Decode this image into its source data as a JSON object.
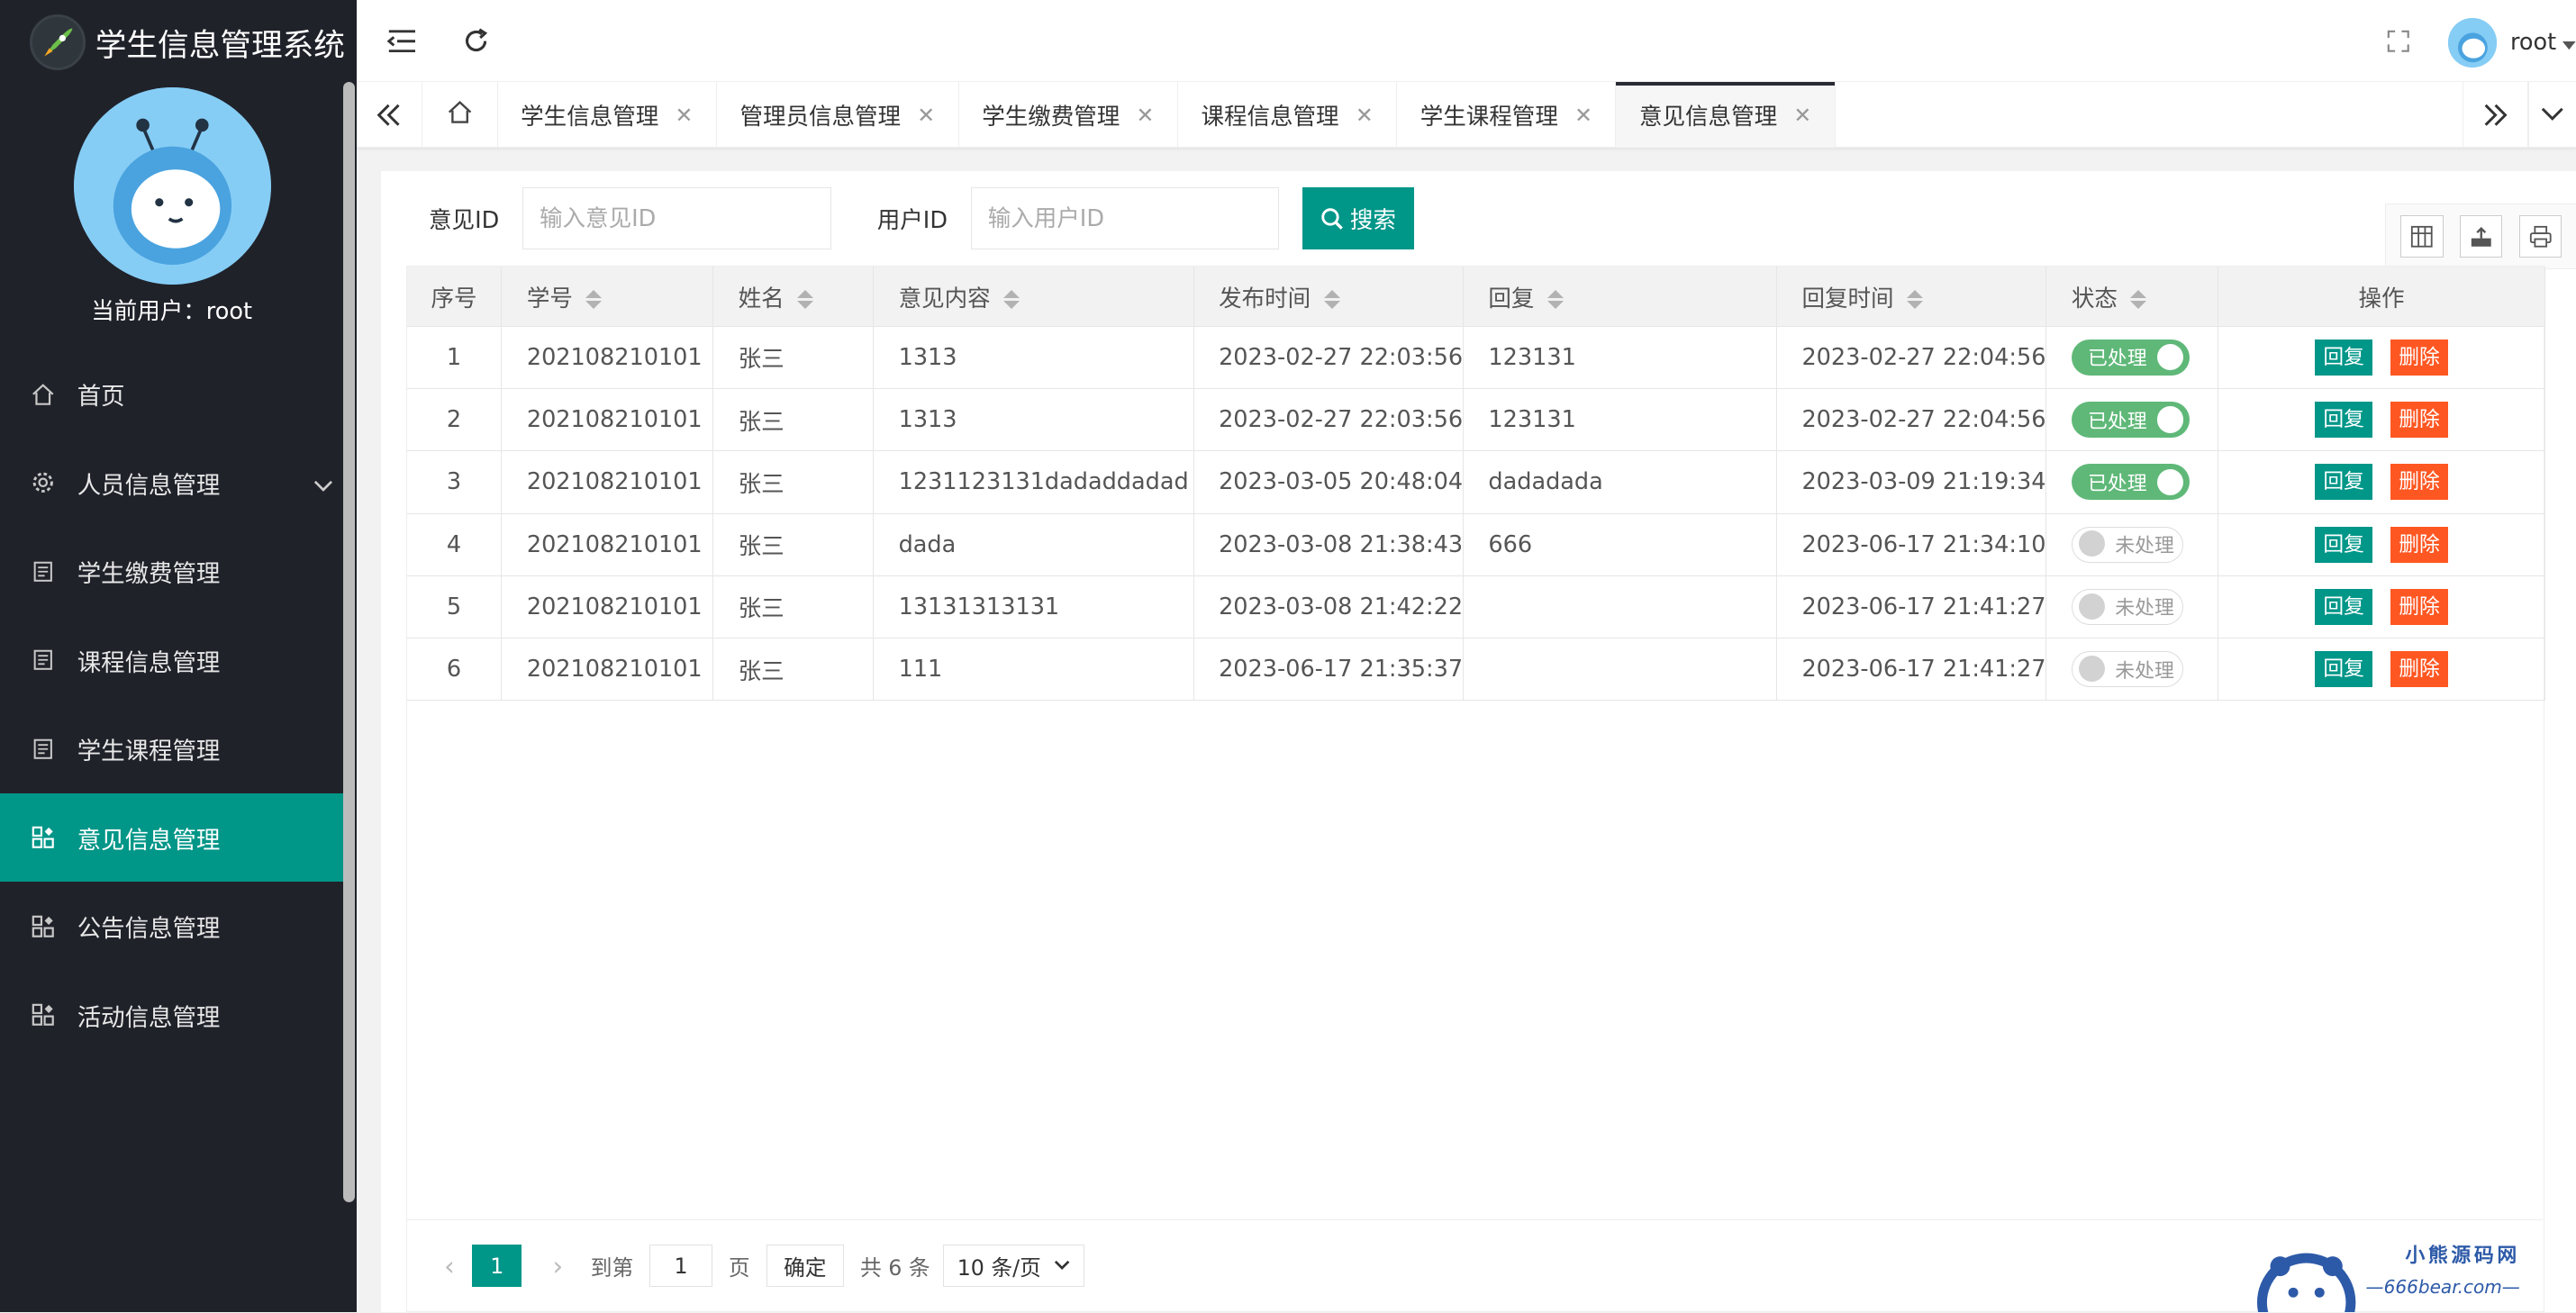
{
  "app": {
    "title": "学生信息管理系统"
  },
  "sidebar": {
    "current_user_label": "当前用户：root",
    "items": [
      {
        "label": "首页",
        "icon": "home-icon"
      },
      {
        "label": "人员信息管理",
        "icon": "gear-icon"
      },
      {
        "label": "学生缴费管理",
        "icon": "doc-icon"
      },
      {
        "label": "课程信息管理",
        "icon": "doc-icon"
      },
      {
        "label": "学生课程管理",
        "icon": "doc-icon"
      },
      {
        "label": "意见信息管理",
        "icon": "app-icon"
      },
      {
        "label": "公告信息管理",
        "icon": "app-icon"
      },
      {
        "label": "活动信息管理",
        "icon": "app-icon"
      }
    ]
  },
  "header": {
    "user": "root"
  },
  "tabs": [
    {
      "label": "学生信息管理"
    },
    {
      "label": "管理员信息管理"
    },
    {
      "label": "学生缴费管理"
    },
    {
      "label": "课程信息管理"
    },
    {
      "label": "学生课程管理"
    },
    {
      "label": "意见信息管理"
    }
  ],
  "search": {
    "opinion_id_label": "意见ID",
    "opinion_id_placeholder": "输入意见ID",
    "user_id_label": "用户ID",
    "user_id_placeholder": "输入用户ID",
    "button": "搜索"
  },
  "table": {
    "headers": [
      "序号",
      "学号",
      "姓名",
      "意见内容",
      "发布时间",
      "回复",
      "回复时间",
      "状态",
      "操作"
    ],
    "rows": [
      {
        "no": "1",
        "sid": "202108210101",
        "name": "张三",
        "content": "1313",
        "time": "2023-02-27 22:03:56",
        "reply": "123131",
        "reply_time": "2023-02-27 22:04:56",
        "status": "已处理",
        "on": true
      },
      {
        "no": "2",
        "sid": "202108210101",
        "name": "张三",
        "content": "1313",
        "time": "2023-02-27 22:03:56",
        "reply": "123131",
        "reply_time": "2023-02-27 22:04:56",
        "status": "已处理",
        "on": true
      },
      {
        "no": "3",
        "sid": "202108210101",
        "name": "张三",
        "content": "1231123131dadaddadad",
        "time": "2023-03-05 20:48:04",
        "reply": "dadadada",
        "reply_time": "2023-03-09 21:19:34",
        "status": "已处理",
        "on": true
      },
      {
        "no": "4",
        "sid": "202108210101",
        "name": "张三",
        "content": "dada",
        "time": "2023-03-08 21:38:43",
        "reply": "666",
        "reply_time": "2023-06-17 21:34:10",
        "status": "未处理",
        "on": false
      },
      {
        "no": "5",
        "sid": "202108210101",
        "name": "张三",
        "content": "13131313131",
        "time": "2023-03-08 21:42:22",
        "reply": "",
        "reply_time": "2023-06-17 21:41:27",
        "status": "未处理",
        "on": false
      },
      {
        "no": "6",
        "sid": "202108210101",
        "name": "张三",
        "content": "111",
        "time": "2023-06-17 21:35:37",
        "reply": "",
        "reply_time": "2023-06-17 21:41:27",
        "status": "未处理",
        "on": false
      }
    ],
    "reply_btn": "回复",
    "delete_btn": "删除"
  },
  "pager": {
    "current": "1",
    "goto_label": "到第",
    "goto_value": "1",
    "page_label": "页",
    "confirm": "确定",
    "total": "共 6 条",
    "per_page": "10 条/页"
  },
  "watermark": {
    "title": "小熊源码网",
    "url": "—666bear.com—"
  },
  "colors": {
    "sidebar_bg": "#20222a",
    "accent": "#009688",
    "danger": "#ff5722",
    "switch_on": "#5fb878"
  }
}
